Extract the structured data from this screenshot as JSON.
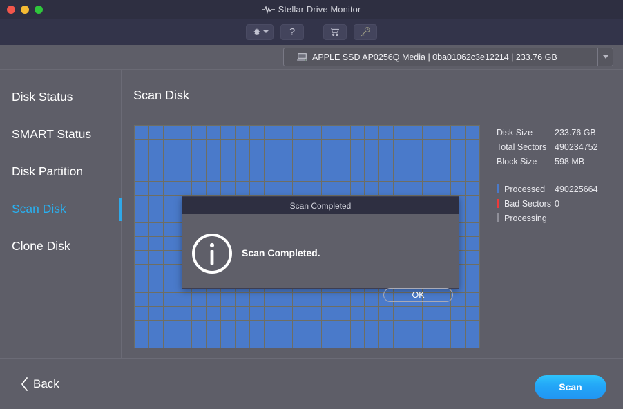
{
  "window": {
    "title": "Stellar Drive Monitor",
    "logo_icon": "pulse-waveform-icon",
    "traffic_lights": [
      {
        "name": "close",
        "color": "#f2564b"
      },
      {
        "name": "minimize",
        "color": "#f5bb33"
      },
      {
        "name": "maximize",
        "color": "#2fc63c"
      }
    ]
  },
  "toolbar": {
    "buttons": [
      {
        "name": "settings-button",
        "icon": "gear-icon",
        "has_caret": true
      },
      {
        "name": "help-button",
        "icon": "question-mark-icon",
        "label": "?"
      },
      {
        "name": "buy-button",
        "icon": "shopping-cart-icon"
      },
      {
        "name": "activate-button",
        "icon": "key-icon"
      }
    ]
  },
  "drive_selector": {
    "icon": "hard-drive-icon",
    "value": "APPLE SSD AP0256Q Media  | 0ba01062c3e12214 | 233.76 GB",
    "arrow_icon": "chevron-down-icon"
  },
  "sidebar": {
    "items": [
      {
        "label": "Disk Status",
        "active": false
      },
      {
        "label": "SMART Status",
        "active": false
      },
      {
        "label": "Disk Partition",
        "active": false
      },
      {
        "label": "Scan Disk",
        "active": true
      },
      {
        "label": "Clone Disk",
        "active": false
      }
    ],
    "active_color": "#29b0f0"
  },
  "main": {
    "heading": "Scan Disk"
  },
  "scan_grid": {
    "columns": 24,
    "rows": 16,
    "cell_color": "#4a7aca",
    "grid_line_color": "#6e6e63",
    "total_cells": 384
  },
  "info_panel": {
    "stats": [
      {
        "key": "Disk Size",
        "value": "233.76 GB"
      },
      {
        "key": "Total Sectors",
        "value": "490234752"
      },
      {
        "key": "Block Size",
        "value": "598 MB"
      }
    ],
    "legend": [
      {
        "key": "Processed",
        "value": "490225664",
        "color": "#4a7aca"
      },
      {
        "key": "Bad Sectors",
        "value": "0",
        "color": "#ee3a3a"
      },
      {
        "key": "Processing",
        "value": "",
        "color": "#8f8f99"
      }
    ]
  },
  "dialog": {
    "title": "Scan Completed",
    "icon": "info-circle-icon",
    "message": "Scan Completed.",
    "ok_label": "OK"
  },
  "footer": {
    "back_icon": "chevron-left-icon",
    "back_label": "Back",
    "scan_label": "Scan",
    "scan_color": "#23a6f7"
  }
}
